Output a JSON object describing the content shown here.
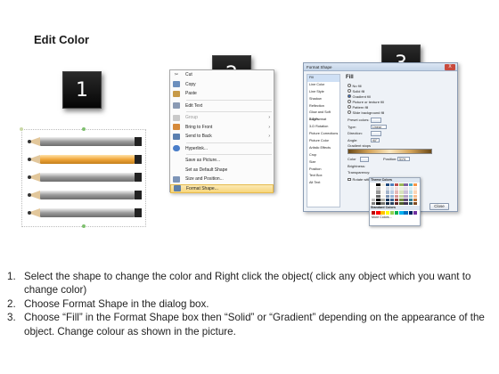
{
  "title": "Edit Color",
  "steps": [
    "1",
    "2",
    "3"
  ],
  "pencils": {
    "colors": {
      "gray": "#8a8a8a",
      "orange": "#f0a63a",
      "tip": "#e2c79b",
      "end": "#222222"
    },
    "count": 5,
    "highlighted_index": 1
  },
  "context_menu": {
    "items": [
      {
        "label": "Cut",
        "icon": "scissors-icon",
        "disabled": false,
        "submenu": false,
        "underline": "t"
      },
      {
        "label": "Copy",
        "icon": "copy-icon",
        "disabled": false,
        "submenu": false
      },
      {
        "label": "Paste",
        "icon": "paste-icon",
        "disabled": false,
        "submenu": false
      },
      {
        "label": "Edit Text",
        "icon": "edit-text-icon",
        "disabled": false,
        "submenu": false
      },
      {
        "label": "Group",
        "icon": "group-icon",
        "disabled": true,
        "submenu": true
      },
      {
        "label": "Bring to Front",
        "icon": "bring-front-icon",
        "disabled": false,
        "submenu": true
      },
      {
        "label": "Send to Back",
        "icon": "send-back-icon",
        "disabled": false,
        "submenu": true
      },
      {
        "label": "Hyperlink...",
        "icon": "hyperlink-icon",
        "disabled": false,
        "submenu": false
      },
      {
        "label": "Save as Picture...",
        "icon": "",
        "disabled": false,
        "submenu": false
      },
      {
        "label": "Set as Default Shape",
        "icon": "",
        "disabled": false,
        "submenu": false
      },
      {
        "label": "Size and Position...",
        "icon": "size-position-icon",
        "disabled": false,
        "submenu": false
      },
      {
        "label": "Format Shape...",
        "icon": "format-shape-icon",
        "disabled": false,
        "submenu": false
      }
    ]
  },
  "format_shape": {
    "title": "Format Shape",
    "close_x": "X",
    "nav": [
      "Fill",
      "Line Color",
      "Line Style",
      "Shadow",
      "Reflection",
      "Glow and Soft Edges",
      "3-D Format",
      "3-D Rotation",
      "Picture Corrections",
      "Picture Color",
      "Artistic Effects",
      "Crop",
      "Size",
      "Position",
      "Text Box",
      "Alt Text"
    ],
    "fill_heading": "Fill",
    "fill_options": [
      {
        "label": "No fill",
        "on": false
      },
      {
        "label": "Solid fill",
        "on": false
      },
      {
        "label": "Gradient fill",
        "on": true
      },
      {
        "label": "Picture or texture fill",
        "on": false
      },
      {
        "label": "Pattern fill",
        "on": false
      },
      {
        "label": "Slide background fill",
        "on": false
      }
    ],
    "props": [
      {
        "label": "Preset colors:",
        "type": "ctrl"
      },
      {
        "label": "Type:",
        "value": "Linear"
      },
      {
        "label": "Direction:",
        "type": "ctrl"
      },
      {
        "label": "Angle:",
        "value": "90°"
      }
    ],
    "gradient_stops_label": "Gradient stops",
    "color_label": "Color",
    "position_label": "Position:",
    "position_value": "51%",
    "brightness_label": "Brightness:",
    "transparency_label": "Transparency:",
    "rotate_label": "Rotate with shape",
    "close_button": "Close",
    "palette": {
      "theme_header": "Theme Colors",
      "standard_header": "Standard Colors",
      "more_label": "More Colors...",
      "theme_colors": [
        "#ffffff",
        "#000000",
        "#eeece1",
        "#1f497d",
        "#4f81bd",
        "#c0504d",
        "#9bbb59",
        "#8064a2",
        "#4bacc6",
        "#f79646"
      ],
      "standard_colors": [
        "#c00000",
        "#ff0000",
        "#ffc000",
        "#ffff00",
        "#92d050",
        "#00b050",
        "#00b0f0",
        "#0070c0",
        "#002060",
        "#7030a0"
      ]
    }
  },
  "instructions": [
    {
      "num": "1.",
      "text": "Select the shape to change the color and Right click the object( click any object which you want to change color)"
    },
    {
      "num": "2.",
      "text": "Choose Format Shape in the dialog box."
    },
    {
      "num": "3.",
      "text": "Choose “Fill” in the Format Shape box then “Solid” or “Gradient” depending on the appearance of the object. Change colour as shown in the picture."
    }
  ]
}
